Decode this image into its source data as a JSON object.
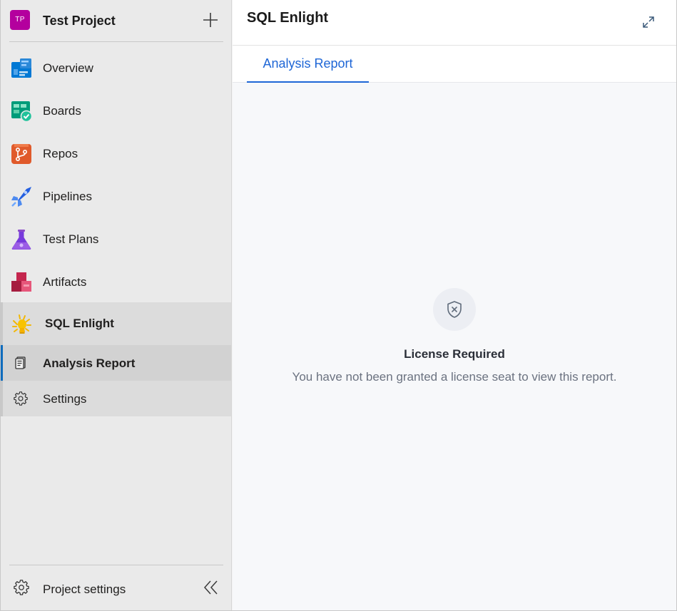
{
  "project": {
    "avatar_initials": "TP",
    "avatar_color": "#b4009e",
    "name": "Test Project",
    "add_icon": "plus-icon"
  },
  "nav": {
    "items": [
      {
        "label": "Overview",
        "icon": "overview-icon"
      },
      {
        "label": "Boards",
        "icon": "boards-icon"
      },
      {
        "label": "Repos",
        "icon": "repos-icon"
      },
      {
        "label": "Pipelines",
        "icon": "pipelines-icon"
      },
      {
        "label": "Test Plans",
        "icon": "test-plans-icon"
      },
      {
        "label": "Artifacts",
        "icon": "artifacts-icon"
      },
      {
        "label": "SQL Enlight",
        "icon": "sql-enlight-icon"
      }
    ],
    "sub_items": [
      {
        "label": "Analysis Report",
        "icon": "report-icon",
        "selected": true
      },
      {
        "label": "Settings",
        "icon": "gear-icon",
        "selected": false
      }
    ]
  },
  "footer": {
    "project_settings": "Project settings",
    "collapse_icon": "double-chevron-left-icon"
  },
  "main": {
    "title": "SQL Enlight",
    "expand_icon": "expand-icon",
    "tabs": [
      {
        "label": "Analysis Report",
        "active": true
      }
    ],
    "empty_state": {
      "icon": "shield-x-icon",
      "title": "License Required",
      "message": "You have not been granted a license seat to view this report."
    }
  },
  "colors": {
    "accent": "#1e66d6",
    "selected_indicator": "#0f6cbd",
    "sidebar_bg": "#eaeaea",
    "content_bg": "#f7f8fa"
  }
}
